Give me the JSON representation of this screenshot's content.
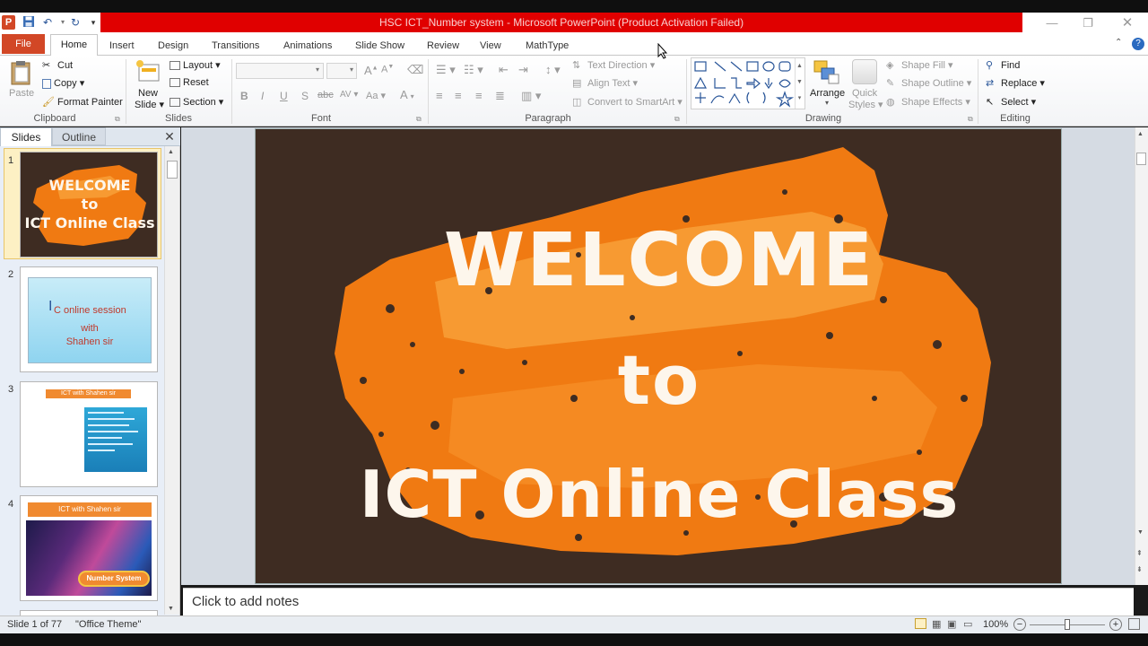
{
  "window": {
    "title": "HSC ICT_Number system  -  Microsoft PowerPoint (Product Activation Failed)",
    "logo_letter": "P"
  },
  "tabs": [
    "File",
    "Home",
    "Insert",
    "Design",
    "Transitions",
    "Animations",
    "Slide Show",
    "Review",
    "View",
    "MathType"
  ],
  "ribbon": {
    "clipboard": {
      "paste": "Paste",
      "cut": "Cut",
      "copy": "Copy",
      "format_painter": "Format Painter",
      "label": "Clipboard"
    },
    "slides": {
      "new_slide_1": "New",
      "new_slide_2": "Slide",
      "layout": "Layout",
      "reset": "Reset",
      "section": "Section",
      "label": "Slides"
    },
    "font": {
      "label": "Font",
      "bold": "B",
      "italic": "I",
      "underline": "U",
      "strike": "S",
      "shadow": "abc",
      "spacing": "AV",
      "case": "Aa",
      "color": "A"
    },
    "paragraph": {
      "label": "Paragraph",
      "text_direction": "Text Direction",
      "align_text": "Align Text",
      "smartart": "Convert to SmartArt"
    },
    "drawing": {
      "label": "Drawing",
      "arrange": "Arrange",
      "quick_styles_1": "Quick",
      "quick_styles_2": "Styles",
      "shape_fill": "Shape Fill",
      "shape_outline": "Shape Outline",
      "shape_effects": "Shape Effects"
    },
    "editing": {
      "label": "Editing",
      "find": "Find",
      "replace": "Replace",
      "select": "Select"
    }
  },
  "slide_pane": {
    "tab_slides": "Slides",
    "tab_outline": "Outline",
    "thumbnails": [
      {
        "number": "1",
        "lines": [
          "WELCOME",
          "to",
          "ICT Online Class"
        ]
      },
      {
        "number": "2",
        "lines": [
          "I",
          "C online session",
          "with",
          "Shahen sir"
        ]
      },
      {
        "number": "3",
        "lines": [
          "ICT with Shahen sir"
        ]
      },
      {
        "number": "4",
        "lines": [
          "ICT with Shahen sir",
          "Number System"
        ]
      }
    ]
  },
  "slide": {
    "line1": "WELCOME",
    "line2": "to",
    "line3": "ICT Online Class"
  },
  "notes_placeholder": "Click to add notes",
  "status": {
    "slide_count": "Slide 1 of 77",
    "theme": "\"Office Theme\"",
    "zoom": "100%"
  },
  "colors": {
    "accent_red": "#e00000",
    "file_tab": "#d24726",
    "slide_bg": "#3e2c22",
    "splash_orange": "#f07a12"
  }
}
